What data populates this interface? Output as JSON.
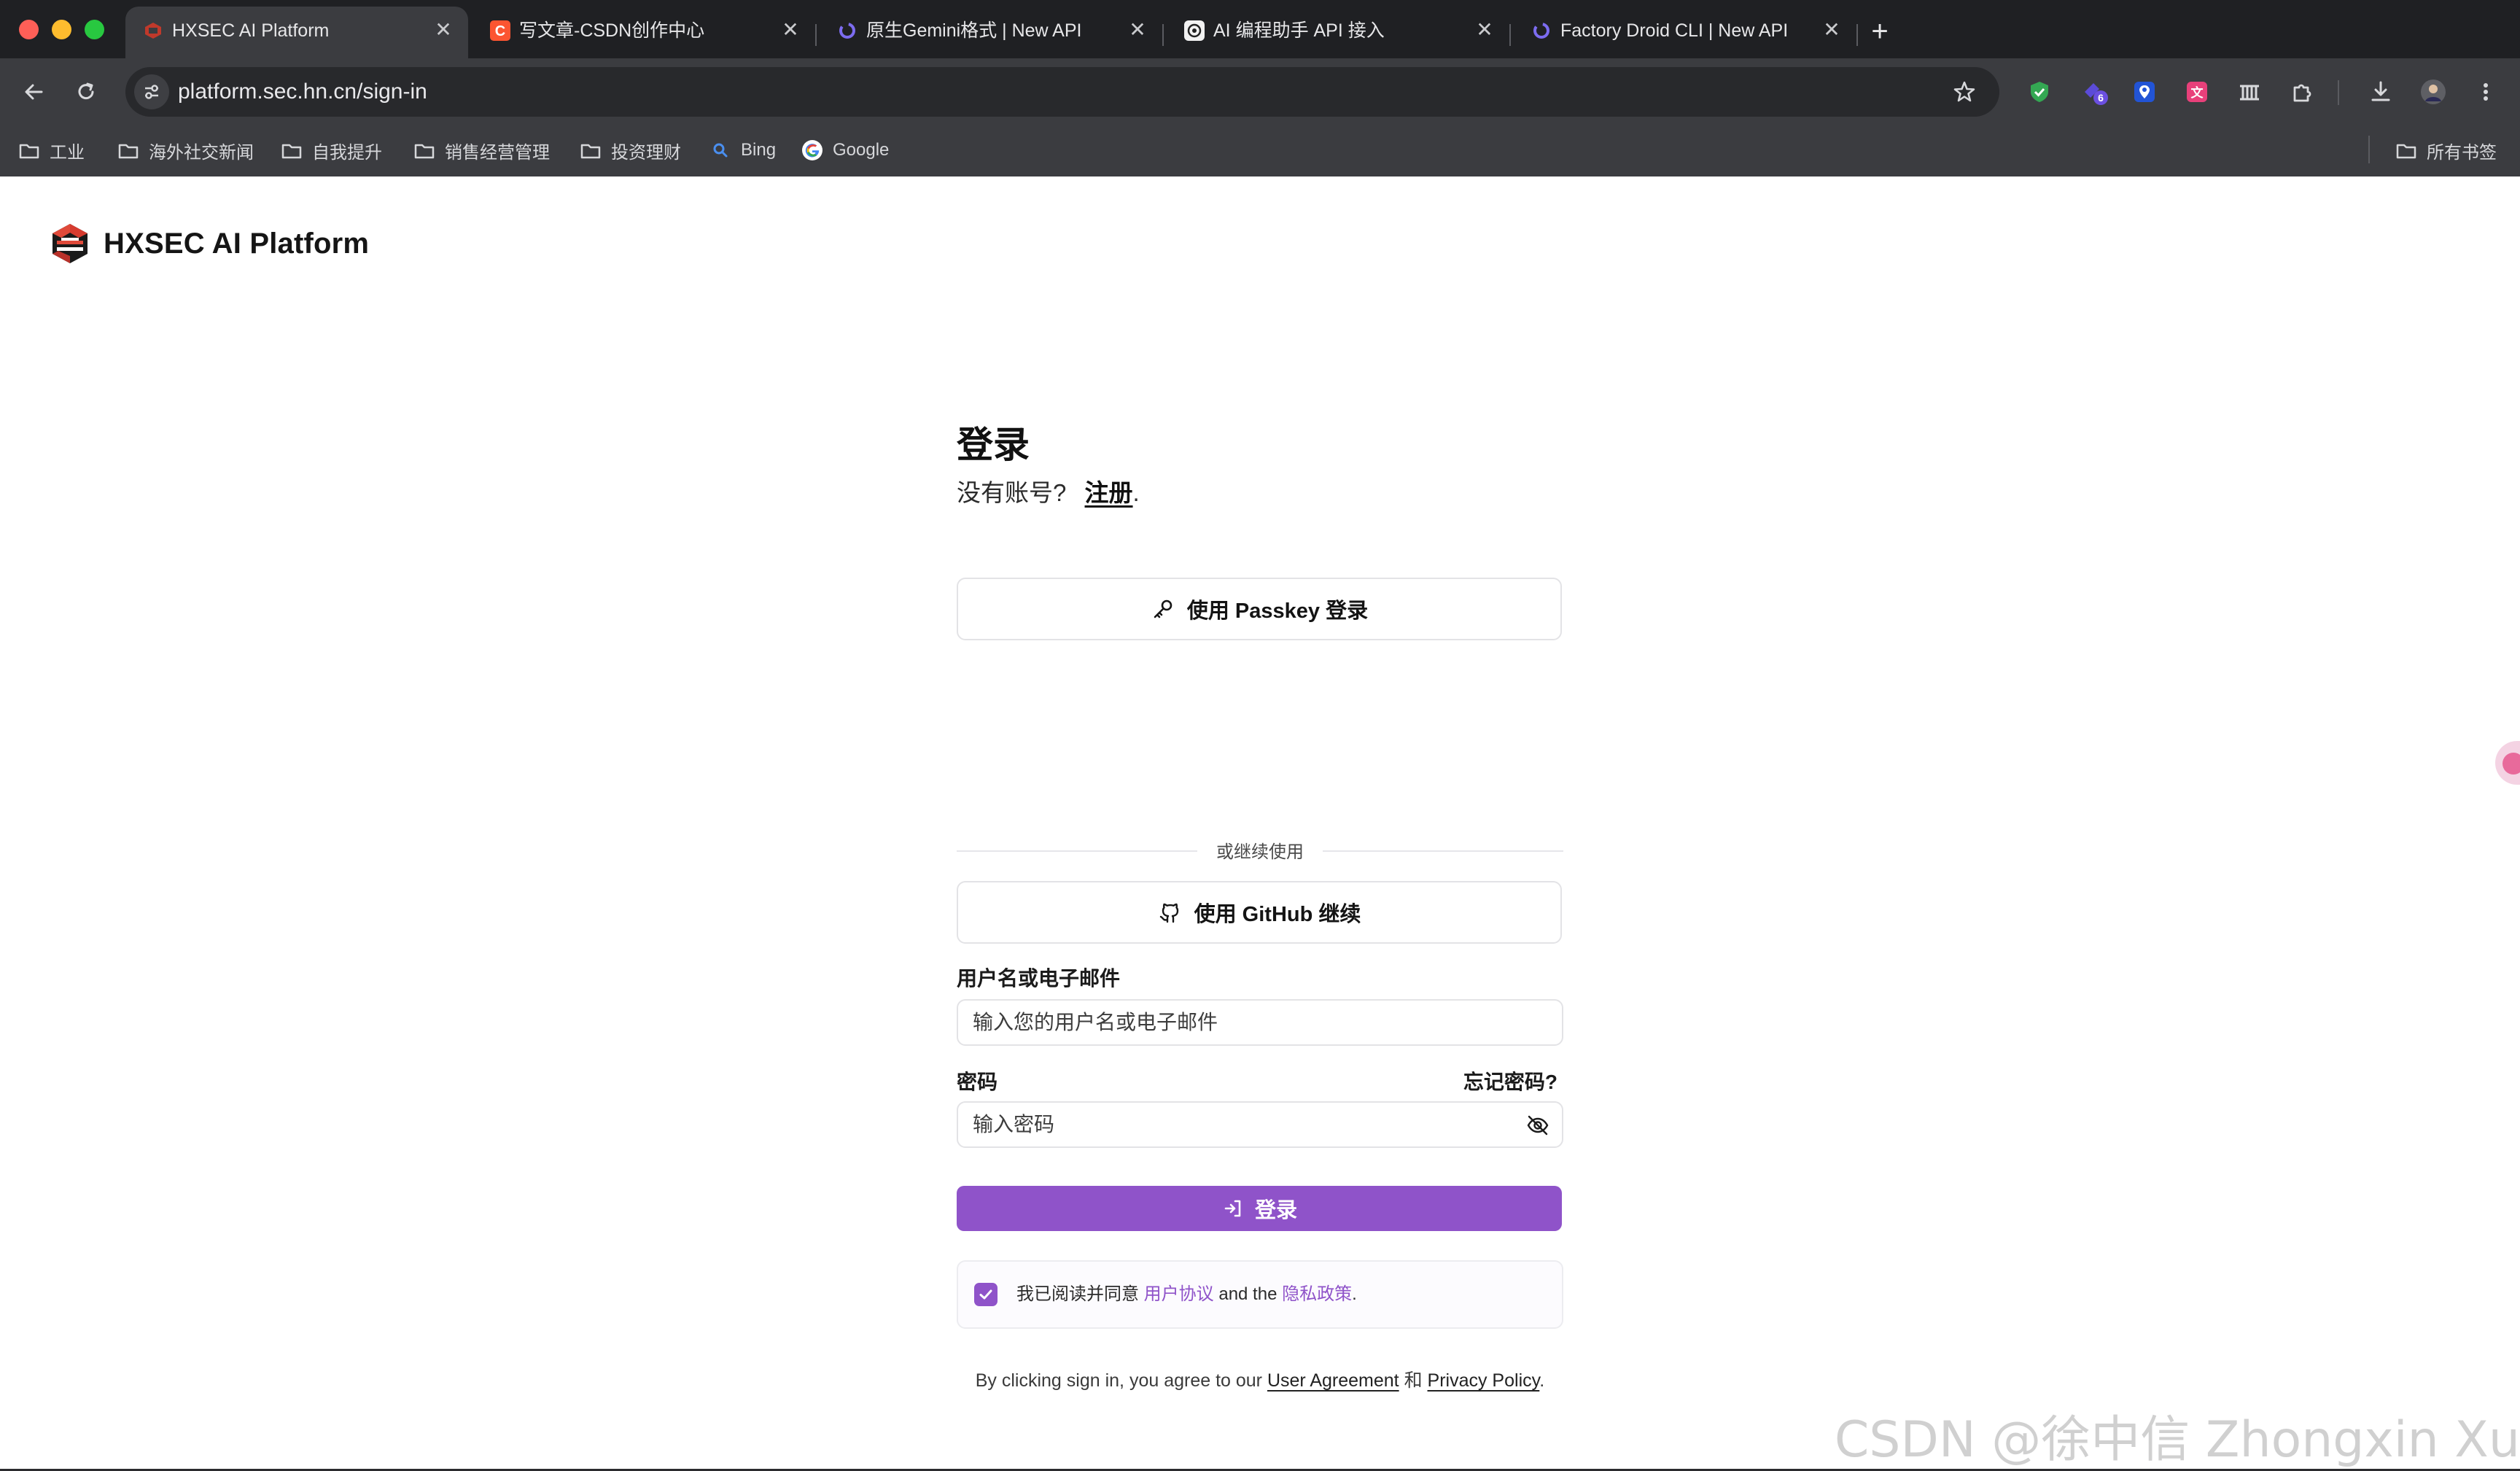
{
  "tabs": [
    {
      "title": "HXSEC AI Platform",
      "active": true,
      "favicon": "hxsec-logo-icon"
    },
    {
      "title": "写文章-CSDN创作中心",
      "active": false,
      "favicon": "csdn-icon"
    },
    {
      "title": "原生Gemini格式 | New API",
      "active": false,
      "favicon": "new-api-icon"
    },
    {
      "title": "AI 编程助手 API 接入",
      "active": false,
      "favicon": "openai-icon"
    },
    {
      "title": "Factory Droid CLI | New API",
      "active": false,
      "favicon": "new-api-icon"
    }
  ],
  "address_bar": {
    "url": "platform.sec.hn.cn/sign-in"
  },
  "extensions": {
    "badge_count": "6"
  },
  "bookmarks": [
    {
      "label": "工业",
      "icon": "folder-icon"
    },
    {
      "label": "海外社交新闻",
      "icon": "folder-icon"
    },
    {
      "label": "自我提升",
      "icon": "folder-icon"
    },
    {
      "label": "销售经营管理",
      "icon": "folder-icon"
    },
    {
      "label": "投资理财",
      "icon": "folder-icon"
    },
    {
      "label": "Bing",
      "icon": "search-icon"
    },
    {
      "label": "Google",
      "icon": "google-icon"
    }
  ],
  "all_bookmarks_label": "所有书签",
  "brand": {
    "name": "HXSEC AI Platform"
  },
  "login": {
    "title": "登录",
    "no_account": "没有账号?",
    "signup_link": "注册",
    "signup_suffix": ".",
    "passkey_button": "使用 Passkey 登录",
    "divider": "或继续使用",
    "github_button": "使用 GitHub 继续",
    "username_label": "用户名或电子邮件",
    "username_placeholder": "输入您的用户名或电子邮件",
    "password_label": "密码",
    "forgot_link": "忘记密码?",
    "password_placeholder": "输入密码",
    "submit_button": "登录",
    "agree_checked": true,
    "agree_prefix": "我已阅读并同意",
    "agree_user_agreement": "用户协议",
    "agree_and": "and the",
    "agree_privacy": "隐私政策",
    "agree_suffix": ".",
    "terms_prefix": "By clicking sign in, you agree to our",
    "terms_user_agreement": "User Agreement",
    "terms_and": "和",
    "terms_privacy": "Privacy Policy",
    "terms_suffix": "."
  },
  "watermark": "CSDN @徐中信 Zhongxin Xu",
  "colors": {
    "accent": "#8f53c9",
    "chrome_dark": "#1f2023",
    "chrome_toolbar": "#3b3c40"
  }
}
